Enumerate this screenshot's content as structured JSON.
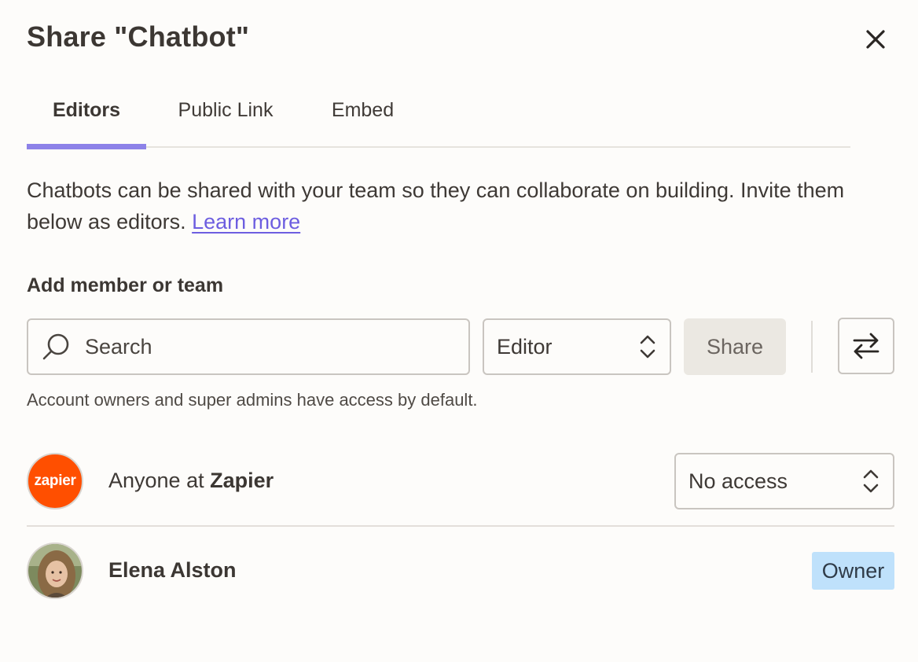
{
  "dialog": {
    "title": "Share \"Chatbot\"",
    "close_icon": "close-icon"
  },
  "tabs": [
    {
      "label": "Editors",
      "active": true
    },
    {
      "label": "Public Link",
      "active": false
    },
    {
      "label": "Embed",
      "active": false
    }
  ],
  "description": {
    "text": "Chatbots can be shared with your team so they can collaborate on building. Invite them below as editors.",
    "link": "Learn more"
  },
  "add_member": {
    "label": "Add member or team",
    "search_placeholder": "Search",
    "role_value": "Editor",
    "share_label": "Share",
    "hint": "Account owners and super admins have access by default."
  },
  "members": [
    {
      "prefix": "Anyone at ",
      "name": "Zapier",
      "avatar_text": "zapier",
      "access": "No access"
    },
    {
      "name": "Elena Alston",
      "role": "Owner"
    }
  ],
  "colors": {
    "accent": "#8d82e8",
    "link": "#6d5ee0",
    "zapier_orange": "#ff4f00",
    "owner_badge": "#bfe1fb"
  }
}
